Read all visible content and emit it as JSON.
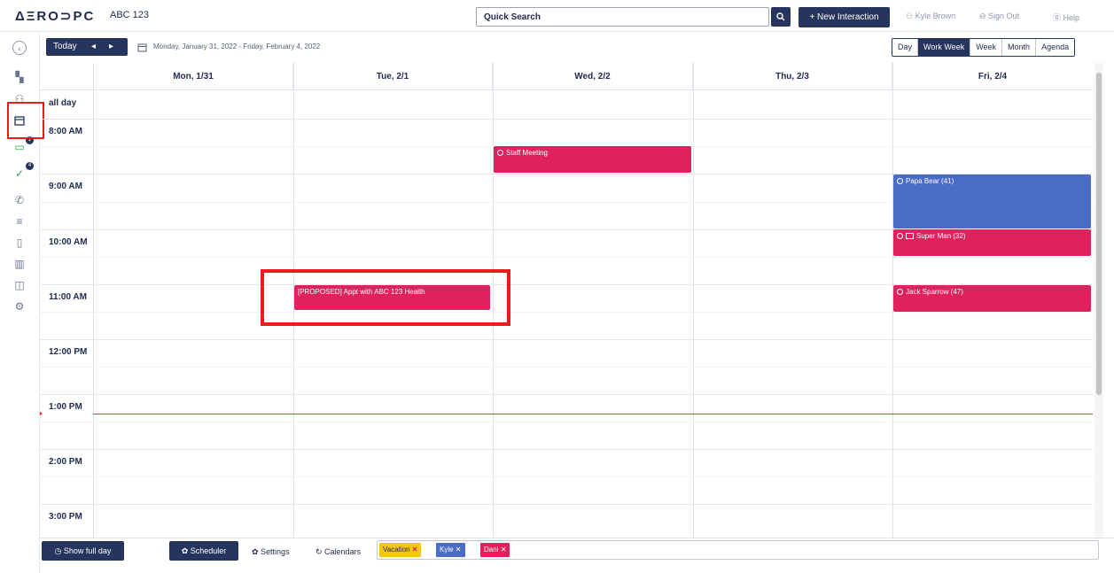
{
  "app": {
    "logo": "ΔΞRO⊃PC",
    "org": "ABC 123"
  },
  "search": {
    "placeholder": "Quick Search",
    "icon": "search-icon"
  },
  "toolbar": {
    "new_interaction": "+ New Interaction"
  },
  "user": {
    "name": "Kyle Brown",
    "sign_out": "Sign Out",
    "help": "Help"
  },
  "nav": {
    "today": "Today",
    "prev": "◂",
    "next": "▸",
    "date_range": "Monday, January 31, 2022 - Friday, February 4, 2022",
    "views": [
      "Day",
      "Work Week",
      "Week",
      "Month",
      "Agenda"
    ],
    "active_view": "Work Week"
  },
  "sidebar": {
    "badges": [
      "1",
      "4"
    ],
    "icons": [
      "back-circle-icon",
      "dashboard-icon",
      "contacts-icon",
      "calendar-icon",
      "messages-icon",
      "tasks-icon",
      "phone-icon",
      "list-icon",
      "document-icon",
      "reports-icon",
      "library-icon",
      "settings-icon"
    ]
  },
  "calendar": {
    "days": [
      "Mon, 1/31",
      "Tue, 2/1",
      "Wed, 2/2",
      "Thu, 2/3",
      "Fri, 2/4"
    ],
    "all_day": "all day",
    "times": [
      "8:00 AM",
      "9:00 AM",
      "10:00 AM",
      "11:00 AM",
      "12:00 PM",
      "1:00 PM",
      "2:00 PM",
      "3:00 PM"
    ],
    "events": [
      {
        "title": "Staff Meeting",
        "day": "Wed, 2/2",
        "start": "8:30 AM",
        "end": "9:00 AM",
        "color": "#e0215e"
      },
      {
        "title": "Papa Bear (41)",
        "day": "Fri, 2/4",
        "start": "9:00 AM",
        "end": "10:00 AM",
        "color": "#4a6bc6"
      },
      {
        "title": "Super Man (32)",
        "day": "Fri, 2/4",
        "start": "10:00 AM",
        "end": "10:30 AM",
        "color": "#e0215e"
      },
      {
        "title": "Jack Sparrow (47)",
        "day": "Fri, 2/4",
        "start": "11:00 AM",
        "end": "11:30 AM",
        "color": "#e0215e"
      },
      {
        "title": "[PROPOSED] Appt with ABC 123 Health",
        "day": "Tue, 2/1",
        "start": "11:00 AM",
        "end": "11:30 AM",
        "color": "#e0215e"
      }
    ]
  },
  "bottom": {
    "show_full_day": "Show full day",
    "scheduler": "Scheduler",
    "settings": "Settings",
    "calendars": "Calendars",
    "filters": [
      {
        "label": "Vacation",
        "color": "#f5c518"
      },
      {
        "label": "Kyle",
        "color": "#4a6bc6"
      },
      {
        "label": "Dani",
        "color": "#e0215e"
      }
    ]
  },
  "colors": {
    "accent": "#25355e",
    "highlight": "#ea1c1c",
    "now_line": "#e0392b"
  }
}
